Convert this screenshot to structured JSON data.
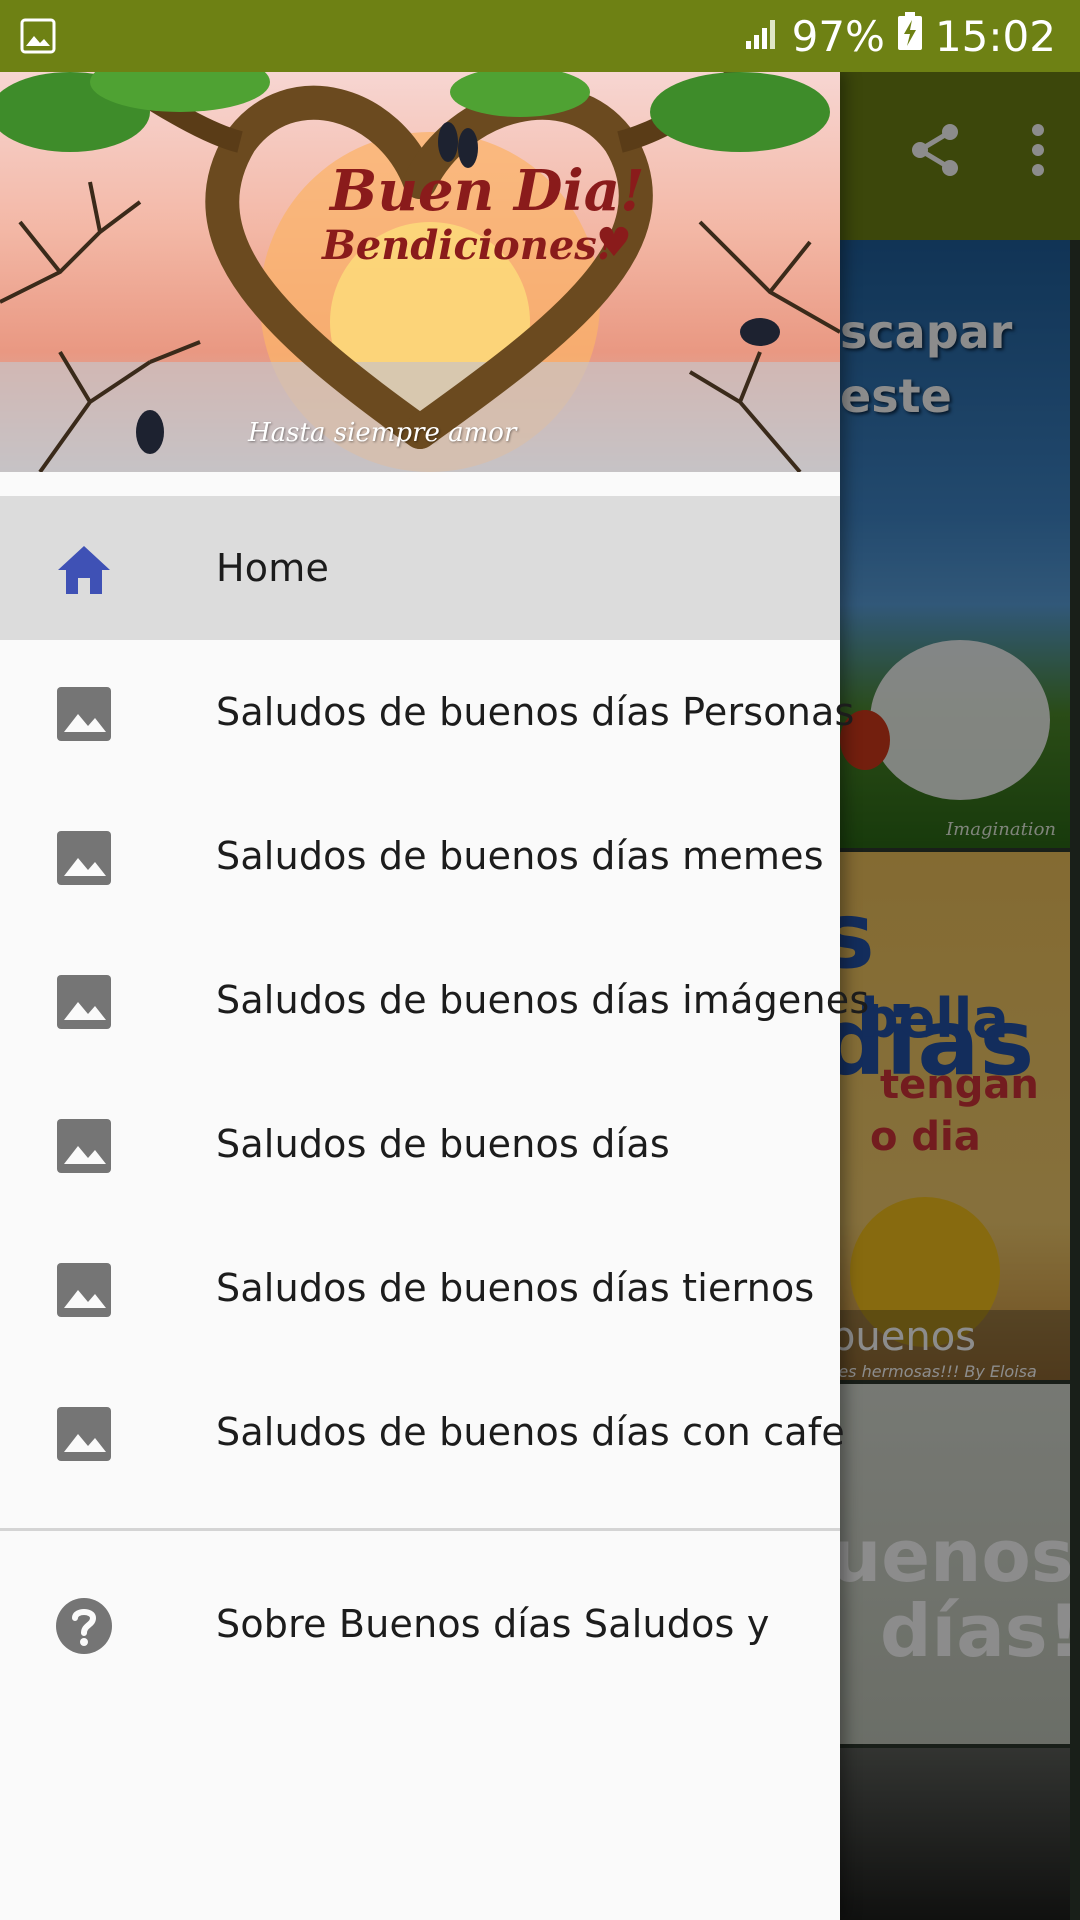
{
  "status_bar": {
    "battery": "97%",
    "time": "15:02",
    "left_icon": "image-notification-icon",
    "signal_icon": "cellular-signal-icon",
    "battery_icon": "battery-charging-icon"
  },
  "colors": {
    "primary": "#6e8114",
    "drawer_background": "#fafafa",
    "active_item_background": "#dcdcdc",
    "active_icon": "#3f51b5",
    "inactive_icon": "#757575"
  },
  "app_toolbar": {
    "share_icon": "share-icon",
    "overflow_icon": "more-vert-icon"
  },
  "background_cards": {
    "card1_lines": [
      "scapar",
      "este"
    ],
    "card1_signature": "Imagination",
    "card2_lines": [
      "s dias",
      "bella",
      "tengan",
      "o dia"
    ],
    "card2_band": "buenos",
    "card2_band_sub": "ses hermosas!!! By Eloisa",
    "card3_lines": [
      "uenos",
      "días!"
    ]
  },
  "drawer": {
    "header": {
      "title_line1": "Buen Dia!",
      "title_line2": "Bendiciones!",
      "heart": "♥",
      "signature": "Hasta siempre amor"
    },
    "items": [
      {
        "label": "Home",
        "icon": "home-icon",
        "active": true
      },
      {
        "label": "Saludos de buenos días Personas",
        "icon": "image-icon",
        "active": false
      },
      {
        "label": "Saludos de buenos días memes",
        "icon": "image-icon",
        "active": false
      },
      {
        "label": "Saludos de buenos días imágenes",
        "icon": "image-icon",
        "active": false
      },
      {
        "label": "Saludos de buenos días",
        "icon": "image-icon",
        "active": false
      },
      {
        "label": "Saludos de buenos días tiernos",
        "icon": "image-icon",
        "active": false
      },
      {
        "label": "Saludos de buenos días con cafe",
        "icon": "image-icon",
        "active": false
      }
    ],
    "about": {
      "label": "Sobre Buenos días Saludos y",
      "icon": "help-icon"
    }
  }
}
